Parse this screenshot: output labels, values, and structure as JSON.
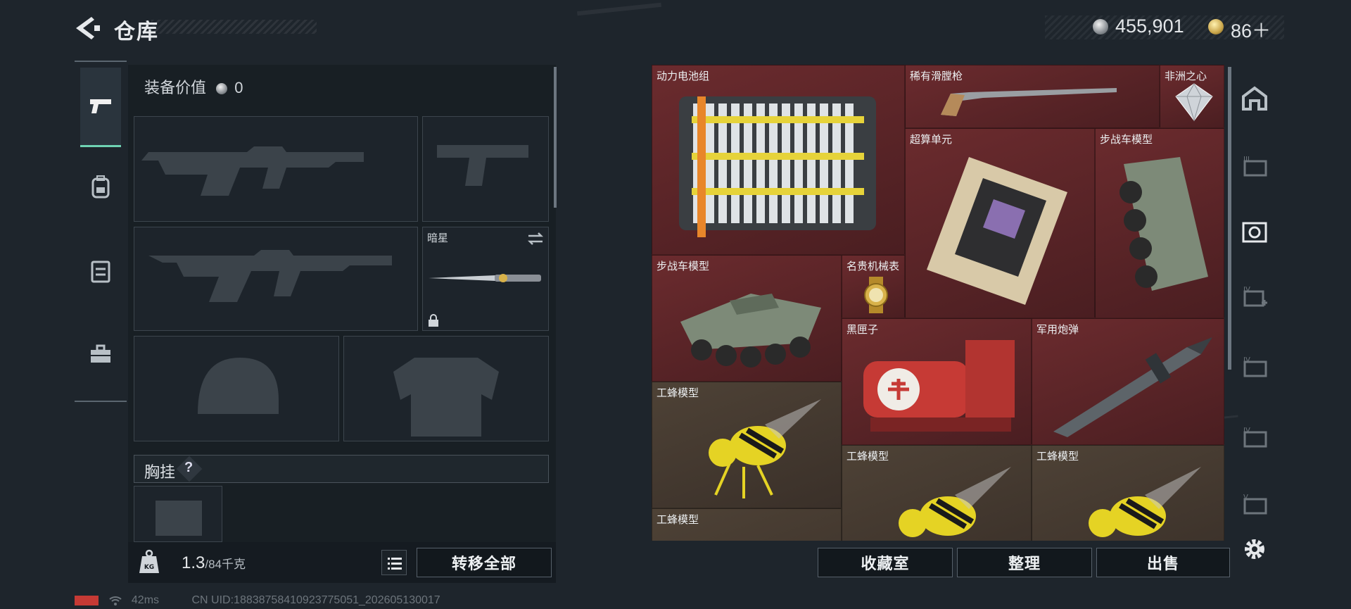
{
  "header": {
    "title": "仓库",
    "silver_amount": "455,901",
    "gold_amount": "86＋"
  },
  "equipment": {
    "value_label": "装备价值",
    "value": "0",
    "melee_name": "暗星",
    "chest_label": "胸挂",
    "chest_help": "?",
    "weight_current": "1.3",
    "weight_max": "/84千克",
    "transfer_all_label": "转移全部"
  },
  "inventory": {
    "items": [
      {
        "name": "动力电池组",
        "rarity": "red"
      },
      {
        "name": "稀有滑膛枪",
        "rarity": "red"
      },
      {
        "name": "非洲之心",
        "rarity": "red"
      },
      {
        "name": "超算单元",
        "rarity": "red"
      },
      {
        "name": "步战车模型",
        "rarity": "red"
      },
      {
        "name": "步战车模型",
        "rarity": "red"
      },
      {
        "name": "名贵机械表",
        "rarity": "red"
      },
      {
        "name": "黑匣子",
        "rarity": "red"
      },
      {
        "name": "军用炮弹",
        "rarity": "red"
      },
      {
        "name": "工蜂模型",
        "rarity": "brown"
      },
      {
        "name": "工蜂模型",
        "rarity": "brown"
      },
      {
        "name": "工蜂模型",
        "rarity": "brown"
      },
      {
        "name": "工蜂模型",
        "rarity": "brown"
      }
    ],
    "collection_room_label": "收藏室",
    "sort_label": "整理",
    "sell_label": "出售"
  },
  "status_bar": {
    "ping": "42ms",
    "uid": "CN UID:18838758410923775051_202605130017"
  },
  "colors": {
    "accent_active_tab": "#6fd3b3",
    "rarity_red": "#6b2b2e",
    "rarity_brown": "#4e4236"
  },
  "rail_icons": [
    "storage-home-icon",
    "storage-tier-iii-icon",
    "storage-active-icon",
    "storage-tier-iv-add-icon",
    "storage-tier-iv-icon",
    "storage-tier-iv-2-icon",
    "storage-tier-v-icon",
    "settings-gear-icon"
  ]
}
